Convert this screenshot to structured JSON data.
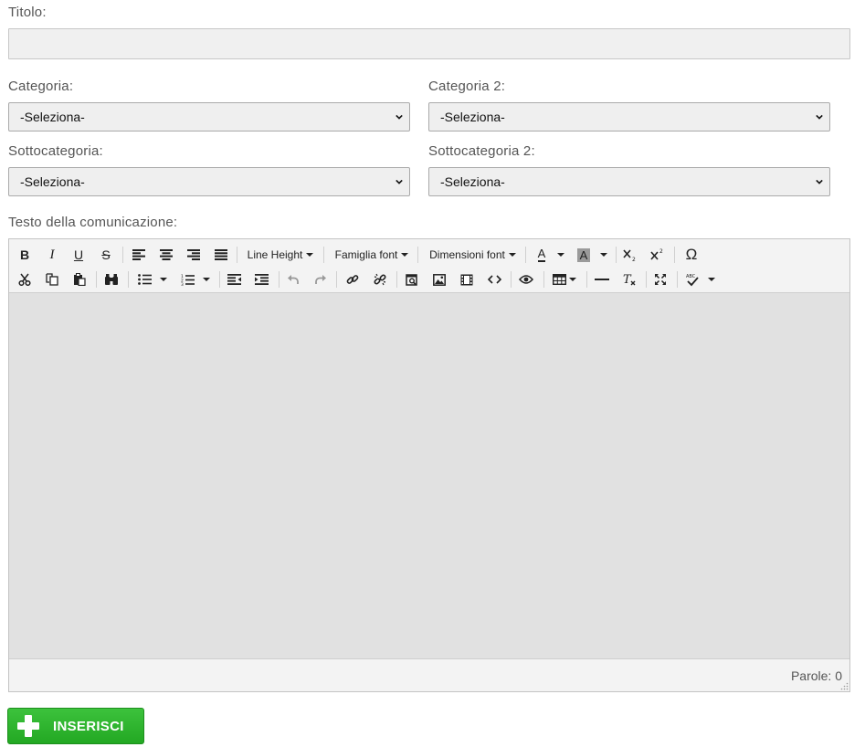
{
  "form": {
    "title_label": "Titolo:",
    "title_value": "",
    "category_label": "Categoria:",
    "category_value": "-Seleziona-",
    "category2_label": "Categoria 2:",
    "category2_value": "-Seleziona-",
    "subcategory_label": "Sottocategoria:",
    "subcategory_value": "-Seleziona-",
    "subcategory2_label": "Sottocategoria 2:",
    "subcategory2_value": "-Seleziona-",
    "text_label": "Testo della comunicazione:"
  },
  "editor": {
    "toolbar_row1": {
      "bold": "B",
      "italic": "I",
      "underline": "U",
      "strike": "S",
      "line_height": "Line Height",
      "font_family": "Famiglia font",
      "font_size": "Dimensioni font",
      "text_color": "A",
      "bg_color": "A",
      "special_char": "Ω"
    },
    "word_count": "Parole: 0"
  },
  "submit": {
    "label": "INSERISCI"
  }
}
